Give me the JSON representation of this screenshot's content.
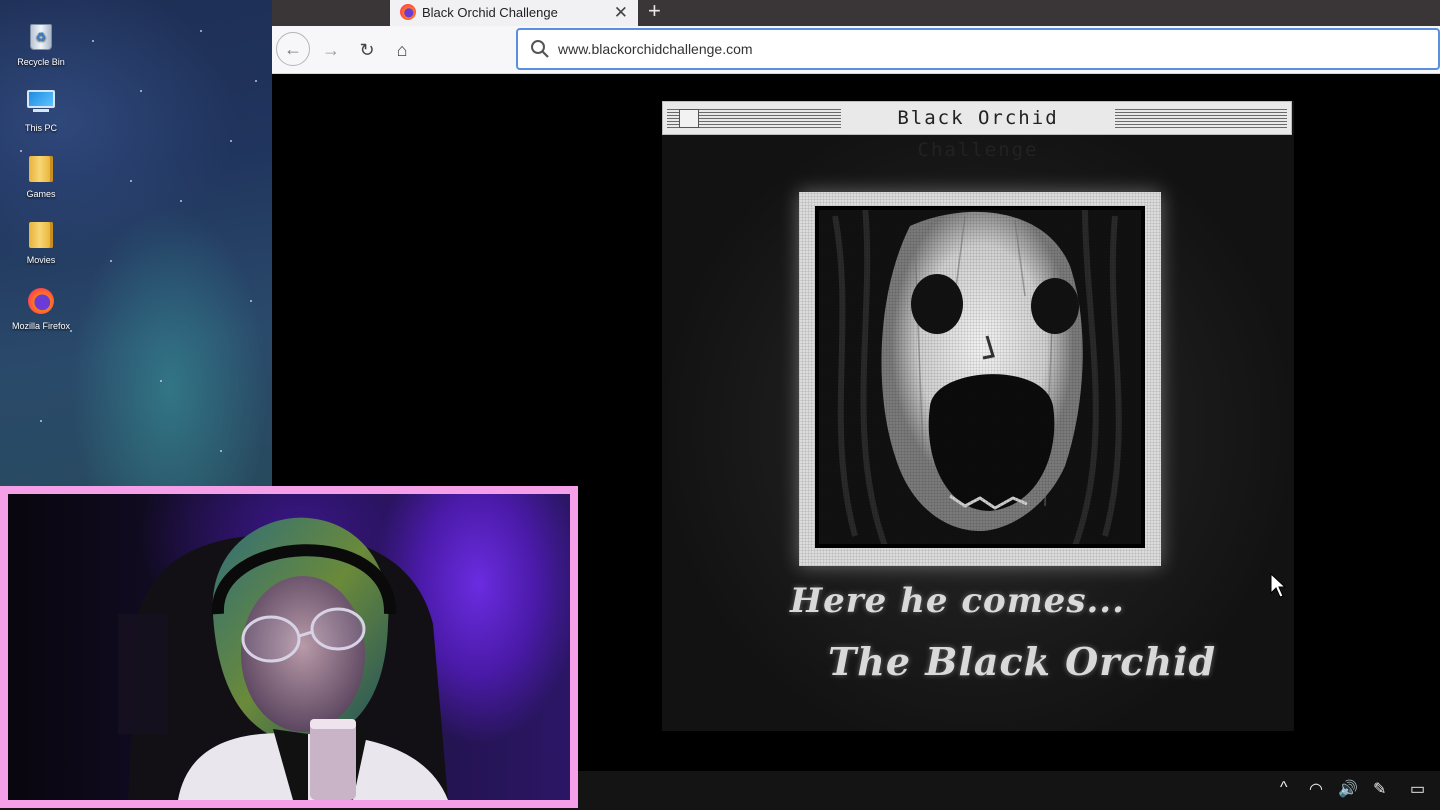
{
  "desktop": {
    "icons": [
      {
        "label": "Recycle Bin",
        "icon": "recycle-bin-icon"
      },
      {
        "label": "This PC",
        "icon": "computer-icon"
      },
      {
        "label": "Games",
        "icon": "folder-icon"
      },
      {
        "label": "Movies",
        "icon": "folder-icon"
      },
      {
        "label": "Mozilla Firefox",
        "icon": "firefox-icon"
      }
    ]
  },
  "browser": {
    "tab_title": "Black Orchid Challenge",
    "tab_close": "✕",
    "new_tab": "+",
    "nav": {
      "back": "←",
      "forward": "→",
      "reload": "↻",
      "home": "⌂"
    },
    "url": "www.blackorchidchallenge.com"
  },
  "page": {
    "window_title": "Black Orchid Challenge",
    "caption_line1": "Here he comes...",
    "caption_line2": "The Black Orchid"
  },
  "taskbar": {
    "tray": {
      "chevron": "^",
      "network": "◠",
      "volume": "🔊",
      "pen": "✎",
      "notifications": "▭"
    }
  },
  "colors": {
    "webcam_border": "#f59fe9",
    "tab_bar": "#3a3536",
    "url_focus": "#5a8fe0"
  }
}
